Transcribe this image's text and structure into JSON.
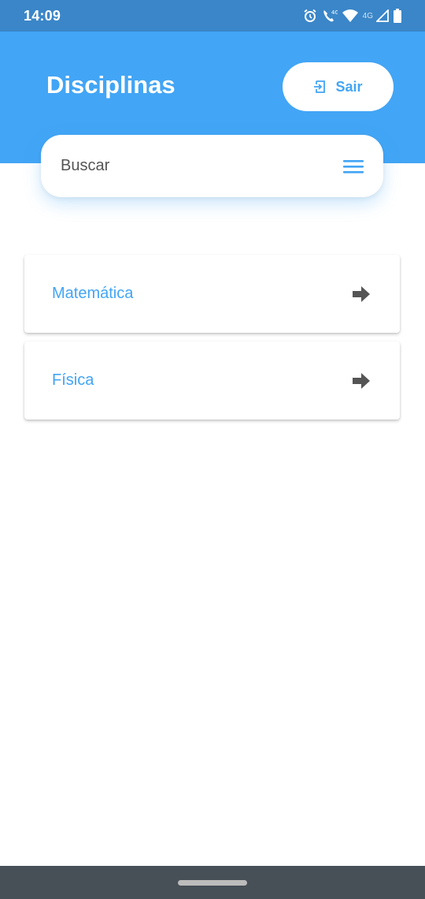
{
  "status_bar": {
    "time": "14:09",
    "network_label": "4G",
    "icons": [
      "alarm-icon",
      "volte-call-icon",
      "wifi-icon",
      "signal-icon",
      "battery-icon"
    ]
  },
  "header": {
    "title": "Disciplinas",
    "logout_label": "Sair",
    "background_color": "#42a5f5"
  },
  "search": {
    "placeholder": "Buscar",
    "value": ""
  },
  "subjects": [
    {
      "label": "Matemática",
      "icon": "arrow-right-icon"
    },
    {
      "label": "Física",
      "icon": "arrow-right-icon"
    }
  ],
  "colors": {
    "accent": "#42a5f5",
    "status_bar": "#3a86c8",
    "nav_bar": "#474f57"
  }
}
